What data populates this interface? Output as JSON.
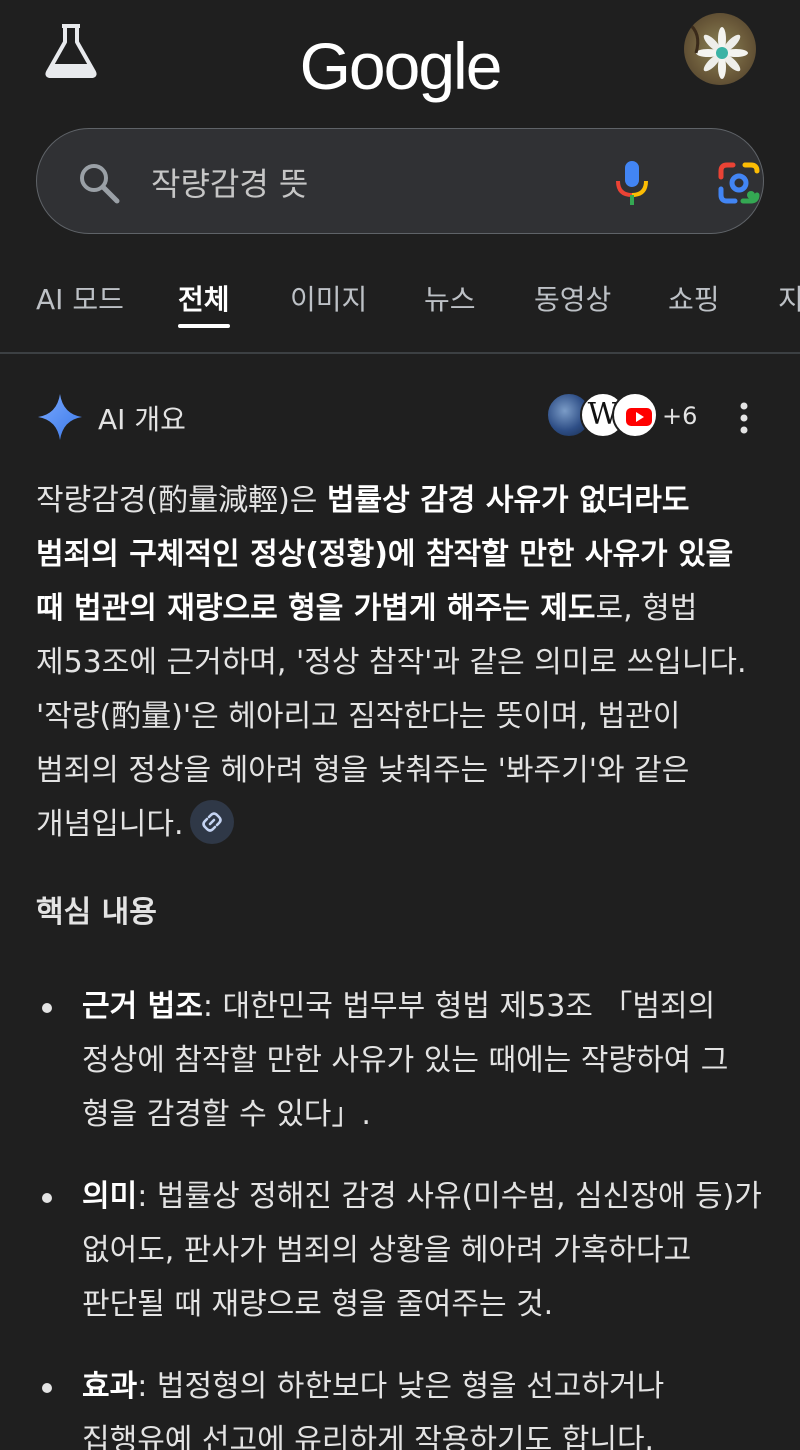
{
  "header": {
    "logo": "Google",
    "labs_icon": "flask-icon",
    "avatar_icon": "profile-avatar"
  },
  "search": {
    "query": "작량감경 뜻",
    "icons": [
      "search-icon",
      "mic-icon",
      "google-lens-icon"
    ]
  },
  "tabs": {
    "items": [
      {
        "label": "AI 모드",
        "active": false
      },
      {
        "label": "전체",
        "active": true
      },
      {
        "label": "이미지",
        "active": false
      },
      {
        "label": "뉴스",
        "active": false
      },
      {
        "label": "동영상",
        "active": false
      },
      {
        "label": "쇼핑",
        "active": false
      },
      {
        "label": "지",
        "active": false
      }
    ]
  },
  "ai_overview": {
    "title": "AI 개요",
    "sources_more": "+6",
    "source_icons": [
      "globe-source-icon",
      "wikipedia-icon",
      "youtube-icon"
    ],
    "summary": {
      "part1": "작량감경(酌量減輕)은 ",
      "bold": "법률상 감경 사유가 없더라도 범죄의 구체적인 정상(정황)에 참작할 만한 사유가 있을 때 법관의 재량으로 형을 가볍게 해주는 제도",
      "part2": "로, 형법 제53조에 근거하며, '정상 참작'과 같은 의미로 쓰입니다. '작량(酌量)'은 헤아리고 짐작한다는 뜻이며, 법관이 범죄의 정상을 헤아려 형을 낮춰주는 '봐주기'와 같은 개념입니다."
    },
    "section_title": "핵심 내용",
    "bullets": [
      {
        "term": "근거 법조",
        "text": ": 대한민국 법무부 형법 제53조 「범죄의 정상에 참작할 만한 사유가 있는 때에는 작량하여 그 형을 감경할 수 있다」."
      },
      {
        "term": "의미",
        "text": ": 법률상 정해진 감경 사유(미수범, 심신장애 등)가 없어도, 판사가 범죄의 상황을 헤아려 가혹하다고 판단될 때 재량으로 형을 줄여주는 것."
      },
      {
        "term": "효과",
        "text": ": 법정형의 하한보다 낮은 형을 선고하거나 집행유예 선고에 유리하게 작용하기도 합니다."
      }
    ]
  },
  "colors": {
    "background": "#1f1f1f",
    "text": "#e3e3e3",
    "search_bg": "#303134",
    "gemini_blue": "#4c8df6"
  }
}
